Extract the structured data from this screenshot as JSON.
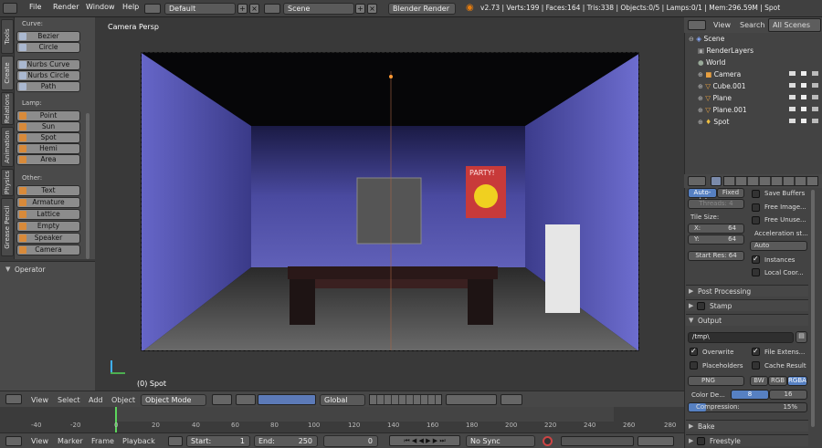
{
  "topbar": {
    "menus": [
      "File",
      "Render",
      "Window",
      "Help"
    ],
    "layout": "Default",
    "scene": "Scene",
    "engine": "Blender Render",
    "stats": "v2.73 | Verts:199 | Faces:164 | Tris:338 | Objects:0/5 | Lamps:0/1 | Mem:296.59M | Spot"
  },
  "tabs": [
    "Tools",
    "Create",
    "Relations",
    "Animation",
    "Physics",
    "Grease Pencil"
  ],
  "tools": {
    "curve_label": "Curve:",
    "curve": [
      "Bezier",
      "Circle"
    ],
    "surface": [
      "Nurbs Curve",
      "Nurbs Circle",
      "Path"
    ],
    "lamp_label": "Lamp:",
    "lamp": [
      "Point",
      "Sun",
      "Spot",
      "Hemi",
      "Area"
    ],
    "other_label": "Other:",
    "other": [
      "Text",
      "Armature",
      "Lattice",
      "Empty",
      "Speaker",
      "Camera"
    ],
    "operator": "Operator"
  },
  "viewport": {
    "title": "Camera Persp",
    "object": "(0) Spot",
    "poster": "PARTY!"
  },
  "header3d": {
    "menus": [
      "View",
      "Select",
      "Add",
      "Object"
    ],
    "mode": "Object Mode",
    "orient": "Global"
  },
  "timeline": {
    "ticks": [
      "-40",
      "-20",
      "0",
      "20",
      "40",
      "60",
      "80",
      "100",
      "120",
      "140",
      "160",
      "180",
      "200",
      "220",
      "240",
      "260",
      "280"
    ],
    "menus": [
      "View",
      "Marker",
      "Frame",
      "Playback"
    ],
    "start_label": "Start:",
    "start": "1",
    "end_label": "End:",
    "end": "250",
    "current": "0",
    "sync": "No Sync"
  },
  "outliner": {
    "tabs": [
      "View",
      "Search",
      "All Scenes"
    ],
    "items": [
      "Scene",
      "RenderLayers",
      "World",
      "Camera",
      "Cube.001",
      "Plane",
      "Plane.001",
      "Spot"
    ]
  },
  "props": {
    "autodet": "Auto-det",
    "fixed": "Fixed",
    "threads": "Threads:",
    "threads_val": "4",
    "tile_size": "Tile Size:",
    "x_label": "X:",
    "x_val": "64",
    "y_label": "Y:",
    "y_val": "64",
    "start_res": "Start Res: 64",
    "save_buffers": "Save Buffers",
    "free_image": "Free Image...",
    "free_unused": "Free Unuse...",
    "accel": "Acceleration st...",
    "accel_val": "Auto",
    "instances": "Instances",
    "local_coords": "Local Coor...",
    "post": "Post Processing",
    "stamp": "Stamp",
    "output": "Output",
    "path": "/tmp\\",
    "overwrite": "Overwrite",
    "file_ext": "File Extens...",
    "placeholders": "Placeholders",
    "cache_result": "Cache Result",
    "format": "PNG",
    "bw": "BW",
    "rgb": "RGB",
    "rgba": "RGBA",
    "color_depth": "Color De...",
    "d8": "8",
    "d16": "16",
    "compression": "Compression:",
    "compression_val": "15%",
    "bake": "Bake",
    "freestyle": "Freestyle"
  }
}
